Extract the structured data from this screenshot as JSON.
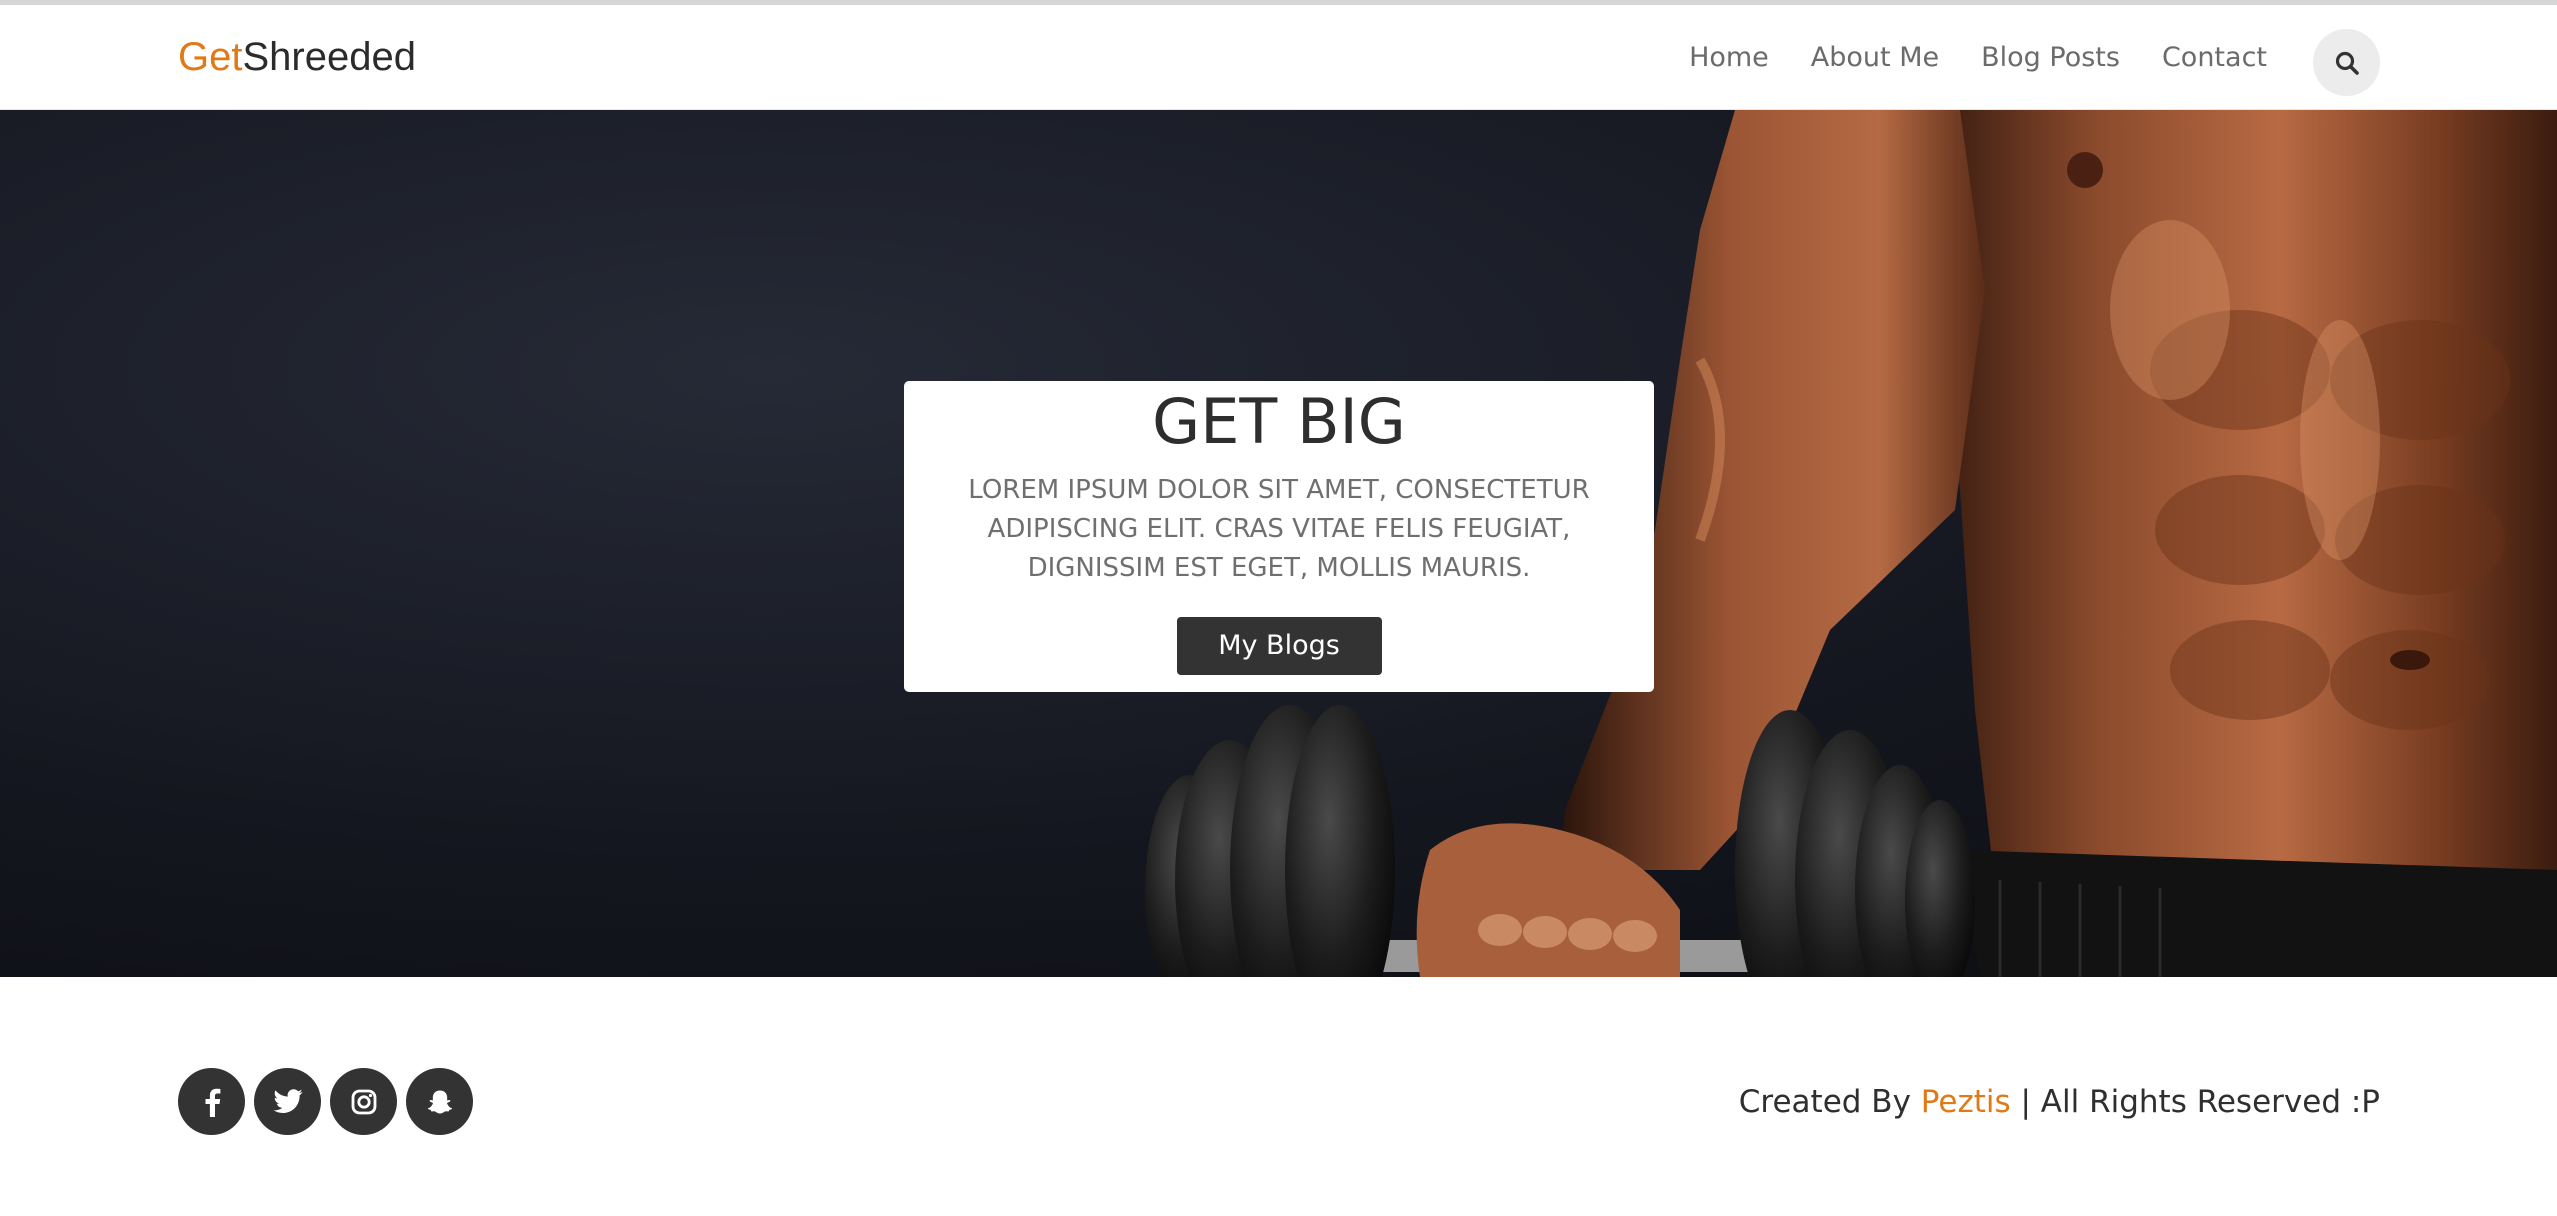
{
  "brand": {
    "part1": "Get",
    "part2": "Shreeded",
    "accent_color": "#e07a17"
  },
  "nav": {
    "items": [
      {
        "label": "Home"
      },
      {
        "label": "About Me"
      },
      {
        "label": "Blog Posts"
      },
      {
        "label": "Contact"
      }
    ],
    "search_icon": "search-icon"
  },
  "hero": {
    "title": "GET BIG",
    "text": "LOREM IPSUM DOLOR SIT AMET, CONSECTETUR ADIPISCING ELIT. CRAS VITAE FELIS FEUGIAT, DIGNISSIM EST EGET, MOLLIS MAURIS.",
    "button_label": "My Blogs",
    "background_image": "muscular man holding dumbbell on dark background"
  },
  "footer": {
    "social_icons": [
      "facebook-icon",
      "twitter-icon",
      "instagram-icon",
      "snapchat-icon"
    ],
    "credit_prefix": "Created By ",
    "credit_author": "Peztis",
    "credit_suffix": " | All Rights Reserved :P"
  }
}
